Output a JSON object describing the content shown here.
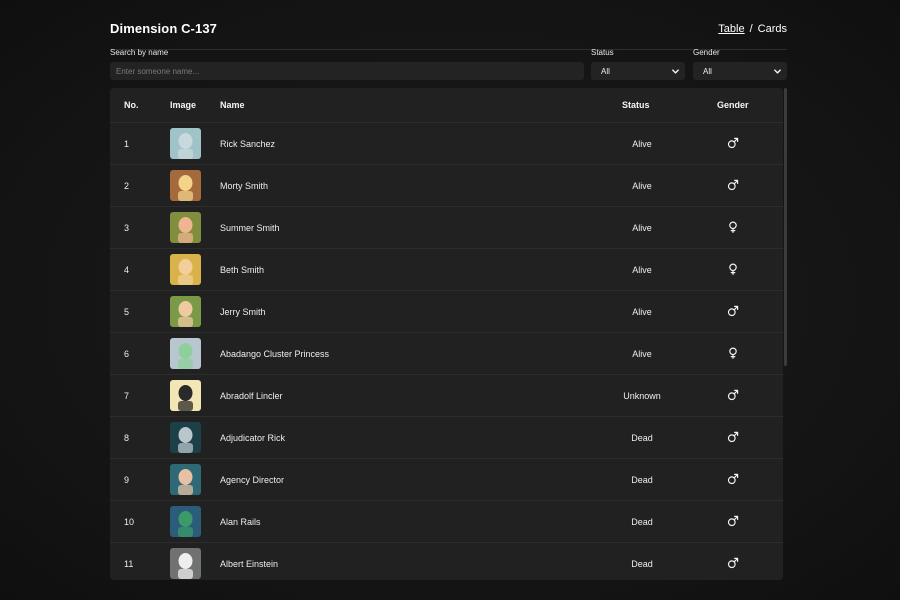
{
  "header": {
    "title": "Dimension C-137",
    "view_table": "Table",
    "view_separator": "/",
    "view_cards": "Cards"
  },
  "filters": {
    "search_label": "Search by name",
    "search_placeholder": "Enter someone name...",
    "search_value": "",
    "status_label": "Status",
    "status_value": "All",
    "gender_label": "Gender",
    "gender_value": "All"
  },
  "table": {
    "columns": [
      "No.",
      "Image",
      "Name",
      "Status",
      "Gender"
    ],
    "rows": [
      {
        "no": "1",
        "name": "Rick Sanchez",
        "status": "Alive",
        "gender": "male"
      },
      {
        "no": "2",
        "name": "Morty Smith",
        "status": "Alive",
        "gender": "male"
      },
      {
        "no": "3",
        "name": "Summer Smith",
        "status": "Alive",
        "gender": "female"
      },
      {
        "no": "4",
        "name": "Beth Smith",
        "status": "Alive",
        "gender": "female"
      },
      {
        "no": "5",
        "name": "Jerry Smith",
        "status": "Alive",
        "gender": "male"
      },
      {
        "no": "6",
        "name": "Abadango Cluster Princess",
        "status": "Alive",
        "gender": "female"
      },
      {
        "no": "7",
        "name": "Abradolf Lincler",
        "status": "Unknown",
        "gender": "male"
      },
      {
        "no": "8",
        "name": "Adjudicator Rick",
        "status": "Dead",
        "gender": "male"
      },
      {
        "no": "9",
        "name": "Agency Director",
        "status": "Dead",
        "gender": "male"
      },
      {
        "no": "10",
        "name": "Alan Rails",
        "status": "Dead",
        "gender": "male"
      },
      {
        "no": "11",
        "name": "Albert Einstein",
        "status": "Dead",
        "gender": "male"
      }
    ]
  },
  "avatar_colors": [
    {
      "bg": "#9fc3c9",
      "fg": "#c9d8dc"
    },
    {
      "bg": "#a56a3c",
      "fg": "#f3d38a"
    },
    {
      "bg": "#7f8f3e",
      "fg": "#f0b48f"
    },
    {
      "bg": "#d9b24a",
      "fg": "#f2cf9a"
    },
    {
      "bg": "#7a9a48",
      "fg": "#efc9a0"
    },
    {
      "bg": "#b8c7cf",
      "fg": "#8fcf9b"
    },
    {
      "bg": "#f2e6b4",
      "fg": "#2a2a2a"
    },
    {
      "bg": "#1d3f48",
      "fg": "#b9c7cc"
    },
    {
      "bg": "#2d6a76",
      "fg": "#e7c0a6"
    },
    {
      "bg": "#2b5d7a",
      "fg": "#3c9a6a"
    },
    {
      "bg": "#6f7270",
      "fg": "#eeeeee"
    }
  ]
}
